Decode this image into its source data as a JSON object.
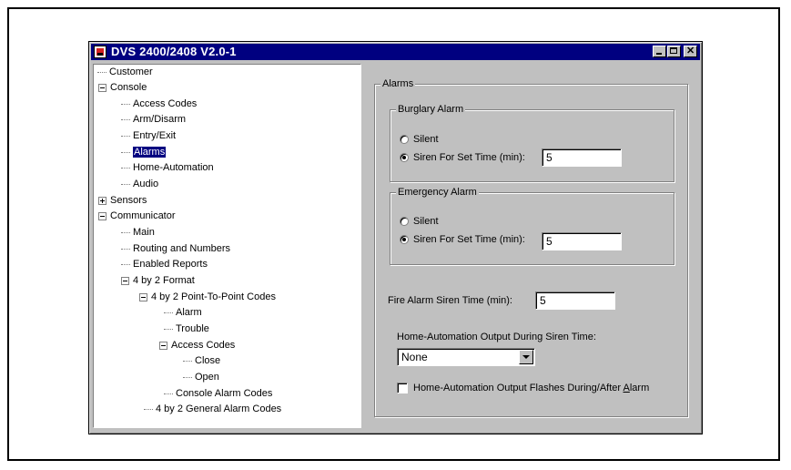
{
  "window": {
    "title": "DVS 2400/2408 V2.0-1"
  },
  "tree": {
    "items": [
      {
        "label": "Customer",
        "expander": "none",
        "selected": false
      },
      {
        "label": "Console",
        "expander": "minus",
        "selected": false
      },
      {
        "label": "Access Codes",
        "expander": "none",
        "selected": false
      },
      {
        "label": "Arm/Disarm",
        "expander": "none",
        "selected": false
      },
      {
        "label": "Entry/Exit",
        "expander": "none",
        "selected": false
      },
      {
        "label": "Alarms",
        "expander": "none",
        "selected": true
      },
      {
        "label": "Home-Automation",
        "expander": "none",
        "selected": false
      },
      {
        "label": "Audio",
        "expander": "none",
        "selected": false
      },
      {
        "label": "Sensors",
        "expander": "plus",
        "selected": false
      },
      {
        "label": "Communicator",
        "expander": "minus",
        "selected": false
      },
      {
        "label": "Main",
        "expander": "none",
        "selected": false
      },
      {
        "label": "Routing and Numbers",
        "expander": "none",
        "selected": false
      },
      {
        "label": "Enabled Reports",
        "expander": "none",
        "selected": false
      },
      {
        "label": "4 by 2 Format",
        "expander": "minus",
        "selected": false
      },
      {
        "label": "4 by 2 Point-To-Point Codes",
        "expander": "minus",
        "selected": false
      },
      {
        "label": "Alarm",
        "expander": "none",
        "selected": false
      },
      {
        "label": "Trouble",
        "expander": "none",
        "selected": false
      },
      {
        "label": "Access Codes",
        "expander": "minus",
        "selected": false
      },
      {
        "label": "Close",
        "expander": "none",
        "selected": false
      },
      {
        "label": "Open",
        "expander": "none",
        "selected": false
      },
      {
        "label": "Console Alarm Codes",
        "expander": "none",
        "selected": false
      },
      {
        "label": "4 by 2 General Alarm Codes",
        "expander": "none",
        "selected": false
      }
    ]
  },
  "alarms": {
    "group_label": "Alarms",
    "burglary": {
      "label": "Burglary Alarm",
      "silent_label": "Silent",
      "siren_label": "Siren For Set Time (min):",
      "siren_value": "5",
      "selected": "siren"
    },
    "emergency": {
      "label": "Emergency Alarm",
      "silent_label": "Silent",
      "siren_label": "Siren For Set Time (min):",
      "siren_value": "5",
      "selected": "siren"
    },
    "fire": {
      "label": "Fire Alarm Siren Time (min):",
      "value": "5"
    },
    "home_automation": {
      "label": "Home-Automation Output During Siren Time:",
      "selected_option": "None",
      "flash_label_pre": "Home-Automation Output Flashes During/After ",
      "flash_label_accel": "A",
      "flash_label_post": "larm",
      "flash_checked": false
    }
  }
}
